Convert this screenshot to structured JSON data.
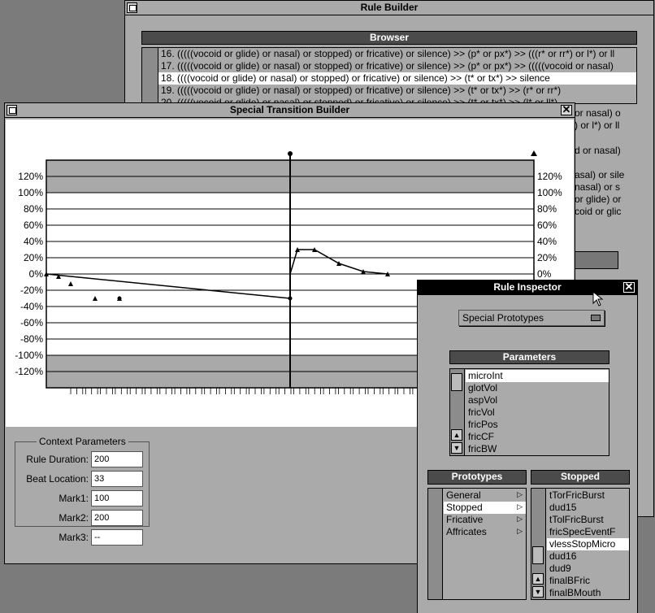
{
  "rule_builder": {
    "title": "Rule Builder",
    "browser_label": "Browser",
    "rules": [
      "16. (((((vocoid or glide) or nasal) or stopped) or fricative) or silence) >> (p* or px*) >> (((r* or rr*) or l*) or ll",
      "17. (((((vocoid or glide) or nasal) or stopped) or fricative) or silence) >> (p* or px*) >> (((((vocoid or nasal)",
      "18. ((((vocoid or glide) or nasal) or stopped) or fricative) or silence) >> (t* or tx*) >> silence",
      "19. (((((vocoid or glide) or nasal) or stopped) or fricative) or silence) >> (t* or tx*) >> (r* or rr*)",
      "20. (((((vocoid or glide) or nasal) or stopped) or fricative) or silence) >> (t* or tx*) >> (l* or ll*)"
    ],
    "right_fragments": [
      "or nasal) o",
      ") or l*) or ll",
      "d or nasal)",
      "asal) or sile",
      "nasal) or s",
      "or glide) or",
      "coid or glic"
    ]
  },
  "transition_builder": {
    "title": "Special Transition Builder",
    "context_title": "Context Parameters",
    "fields": [
      {
        "label": "Rule Duration:",
        "value": "200"
      },
      {
        "label": "Beat Location:",
        "value": "33"
      },
      {
        "label": "Mark1:",
        "value": "100"
      },
      {
        "label": "Mark2:",
        "value": "200"
      },
      {
        "label": "Mark3:",
        "value": "--"
      }
    ]
  },
  "chart_data": {
    "type": "line",
    "y_ticks": [
      "120%",
      "100%",
      "80%",
      "60%",
      "40%",
      "20%",
      "0%",
      "-20%",
      "-40%",
      "-60%",
      "-80%",
      "-100%",
      "-120%"
    ],
    "ylim": [
      -140,
      140
    ],
    "xlim": [
      0,
      200
    ],
    "series": [
      {
        "points": [
          [
            0,
            0
          ],
          [
            100,
            -30
          ]
        ],
        "markers": [
          [
            0,
            0
          ],
          [
            5,
            -3
          ],
          [
            10,
            -12
          ],
          [
            20,
            -30
          ],
          [
            30,
            -30
          ]
        ]
      },
      {
        "points": [
          [
            100,
            0
          ],
          [
            103,
            30
          ],
          [
            110,
            30
          ],
          [
            120,
            13
          ],
          [
            130,
            3
          ],
          [
            140,
            0
          ]
        ],
        "markers": [
          [
            103,
            30
          ],
          [
            110,
            30
          ],
          [
            120,
            13
          ],
          [
            130,
            3
          ],
          [
            140,
            0
          ]
        ]
      }
    ],
    "grid": true
  },
  "inspector": {
    "title": "Rule Inspector",
    "dropdown": "Special Prototypes",
    "parameters_label": "Parameters",
    "parameters": [
      "microInt",
      "glotVol",
      "aspVol",
      "fricVol",
      "fricPos",
      "fricCF",
      "fricBW"
    ],
    "prototypes_label": "Prototypes",
    "prototypes": [
      "General",
      "Stopped",
      "Fricative",
      "Affricates"
    ],
    "stopped_label": "Stopped",
    "stopped_items": [
      "tTorFricBurst",
      "dud15",
      "tTolFricBurst",
      "fricSpecEventF",
      "vlessStopMicro",
      "dud16",
      "dud9",
      "finalBFric",
      "finalBMouth"
    ]
  }
}
